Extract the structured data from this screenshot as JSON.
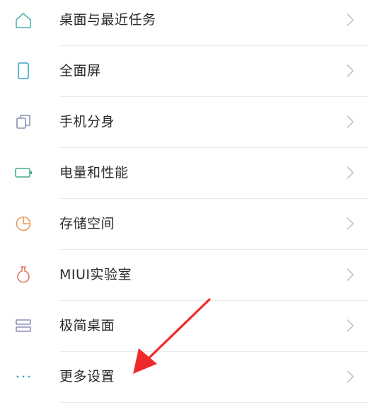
{
  "settings": {
    "items": [
      {
        "label": "桌面与最近任务",
        "icon": "home-icon"
      },
      {
        "label": "全面屏",
        "icon": "phone-screen-icon"
      },
      {
        "label": "手机分身",
        "icon": "clone-icon"
      },
      {
        "label": "电量和性能",
        "icon": "battery-icon"
      },
      {
        "label": "存储空间",
        "icon": "pie-chart-icon"
      },
      {
        "label": "MIUI实验室",
        "icon": "flask-icon"
      },
      {
        "label": "极简桌面",
        "icon": "layout-icon"
      },
      {
        "label": "更多设置",
        "icon": "more-dots-icon"
      }
    ]
  },
  "colors": {
    "home": "#4fb3b0",
    "screen": "#3aa6c8",
    "clone": "#8a8fb8",
    "battery": "#3fae8c",
    "storage": "#e69a5c",
    "lab": "#e07a5f",
    "layout": "#8a8fb8",
    "more": "#3aa6c8",
    "annotation_arrow": "#f02a2a"
  }
}
